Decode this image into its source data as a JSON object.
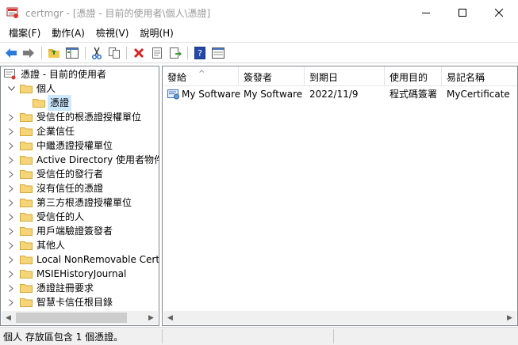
{
  "window": {
    "title": "certmgr - [憑證 - 目前的使用者\\個人\\憑證]"
  },
  "menu": [
    "檔案(F)",
    "動作(A)",
    "檢視(V)",
    "說明(H)"
  ],
  "toolbar": {
    "icons": [
      "back-arrow-icon",
      "forward-arrow-icon",
      "up-folder-icon",
      "show-hide-tree-icon",
      "cut-icon",
      "copy-icon",
      "delete-icon",
      "properties-icon",
      "export-list-icon",
      "help-icon",
      "view-icon"
    ]
  },
  "tree": {
    "root": "憑證 - 目前的使用者",
    "items": [
      {
        "label": "個人",
        "expanded": true
      },
      {
        "label": "憑證",
        "selected": true
      },
      {
        "label": "受信任的根憑證授權單位"
      },
      {
        "label": "企業信任"
      },
      {
        "label": "中繼憑證授權單位"
      },
      {
        "label": "Active Directory 使用者物件"
      },
      {
        "label": "受信任的發行者"
      },
      {
        "label": "沒有信任的憑證"
      },
      {
        "label": "第三方根憑證授權單位"
      },
      {
        "label": "受信任的人"
      },
      {
        "label": "用戶端驗證簽發者"
      },
      {
        "label": "其他人"
      },
      {
        "label": "Local NonRemovable Certificates"
      },
      {
        "label": "MSIEHistoryJournal"
      },
      {
        "label": "憑證註冊要求"
      },
      {
        "label": "智慧卡信任根目錄"
      }
    ]
  },
  "list": {
    "columns": [
      "發給",
      "簽發者",
      "到期日",
      "使用目的",
      "易記名稱"
    ],
    "rows": [
      [
        "My Software",
        "My Software",
        "2022/11/9",
        "程式碼簽署",
        "MyCertificate"
      ]
    ]
  },
  "status": {
    "text": "個人 存放區包含 1 個憑證。"
  },
  "colors": {
    "selection": "#cce8ff",
    "folder": "#f6d478",
    "border": "#828790"
  }
}
